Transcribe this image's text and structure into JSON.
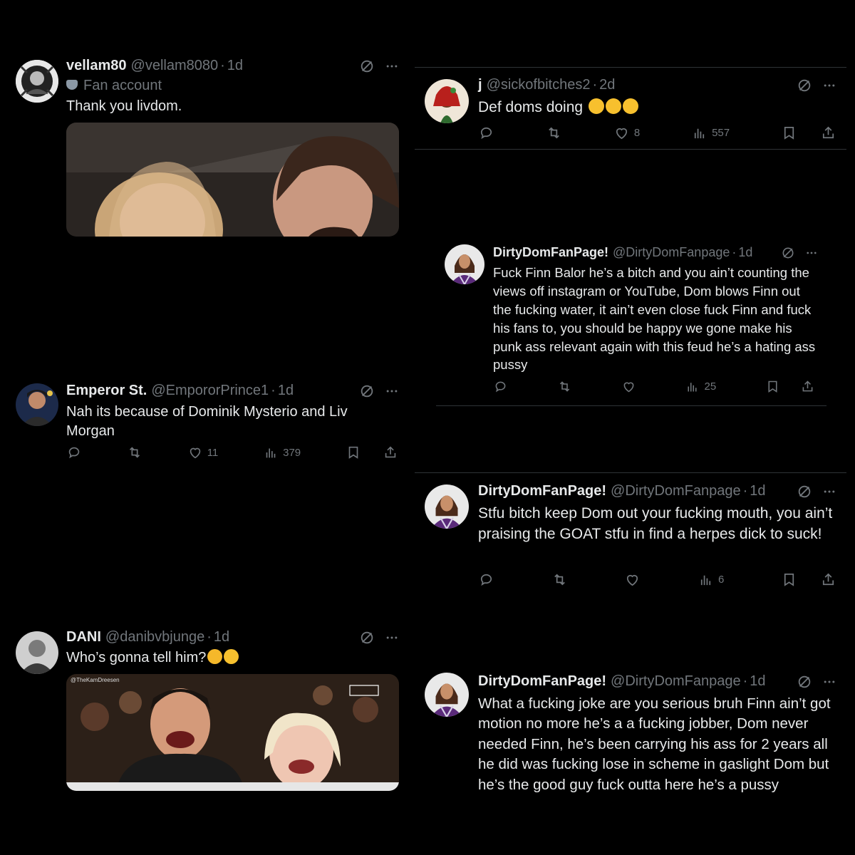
{
  "tweets": [
    {
      "name": "vellam80",
      "handle": "@vellam8080",
      "dot": "·",
      "time": "1d",
      "badge": "Fan account",
      "text": "Thank you livdom.",
      "media": "image of a woman and a man"
    },
    {
      "name": "Emperor St.",
      "handle": "@EmpororPrince1",
      "dot": "·",
      "time": "1d",
      "text": "Nah its because of Dominik Mysterio and Liv Morgan",
      "likes": "11",
      "views": "379"
    },
    {
      "name": "DANI",
      "handle": "@danibvbjunge",
      "dot": "·",
      "time": "1d",
      "text": "Who’s gonna tell him?",
      "media_caption": "@TheKamDreesen"
    },
    {
      "name": "j",
      "handle": "@sickofbitches2",
      "dot": "·",
      "time": "2d",
      "text": "Def doms doing",
      "likes": "8",
      "views": "557"
    },
    {
      "name": "DirtyDomFanPage!",
      "handle": "@DirtyDomFanpage",
      "dot": "·",
      "time": "1d",
      "text": "Fuck Finn Balor he’s a bitch and you ain’t counting the views off instagram or YouTube, Dom blows Finn out the fucking water, it ain’t even close fuck Finn and fuck his fans to, you should be happy we gone make his punk ass relevant again with this feud he’s a hating ass pussy",
      "views": "25"
    },
    {
      "name": "DirtyDomFanPage!",
      "handle": "@DirtyDomFanpage",
      "dot": "·",
      "time": "1d",
      "text": "Stfu bitch keep Dom out your fucking mouth, you ain’t praising the GOAT stfu in find a herpes dick to suck!",
      "views": "6"
    },
    {
      "name": "DirtyDomFanPage!",
      "handle": "@DirtyDomFanpage",
      "dot": "·",
      "time": "1d",
      "text": "What a fucking joke are you serious bruh Finn ain’t got motion no more he’s a a fucking jobber, Dom never needed Finn, he’s been carrying his ass for 2 years all he did was fucking lose in scheme in gaslight Dom but he’s the good guy fuck outta here he’s a pussy"
    }
  ],
  "colors": {
    "background": "#000000",
    "text": "#e7e9ea",
    "muted": "#71767b",
    "divider": "#2f3336"
  },
  "icons": [
    "grok-icon",
    "more-icon",
    "reply-icon",
    "retweet-icon",
    "like-icon",
    "views-icon",
    "bookmark-icon",
    "share-icon",
    "mask-icon"
  ]
}
